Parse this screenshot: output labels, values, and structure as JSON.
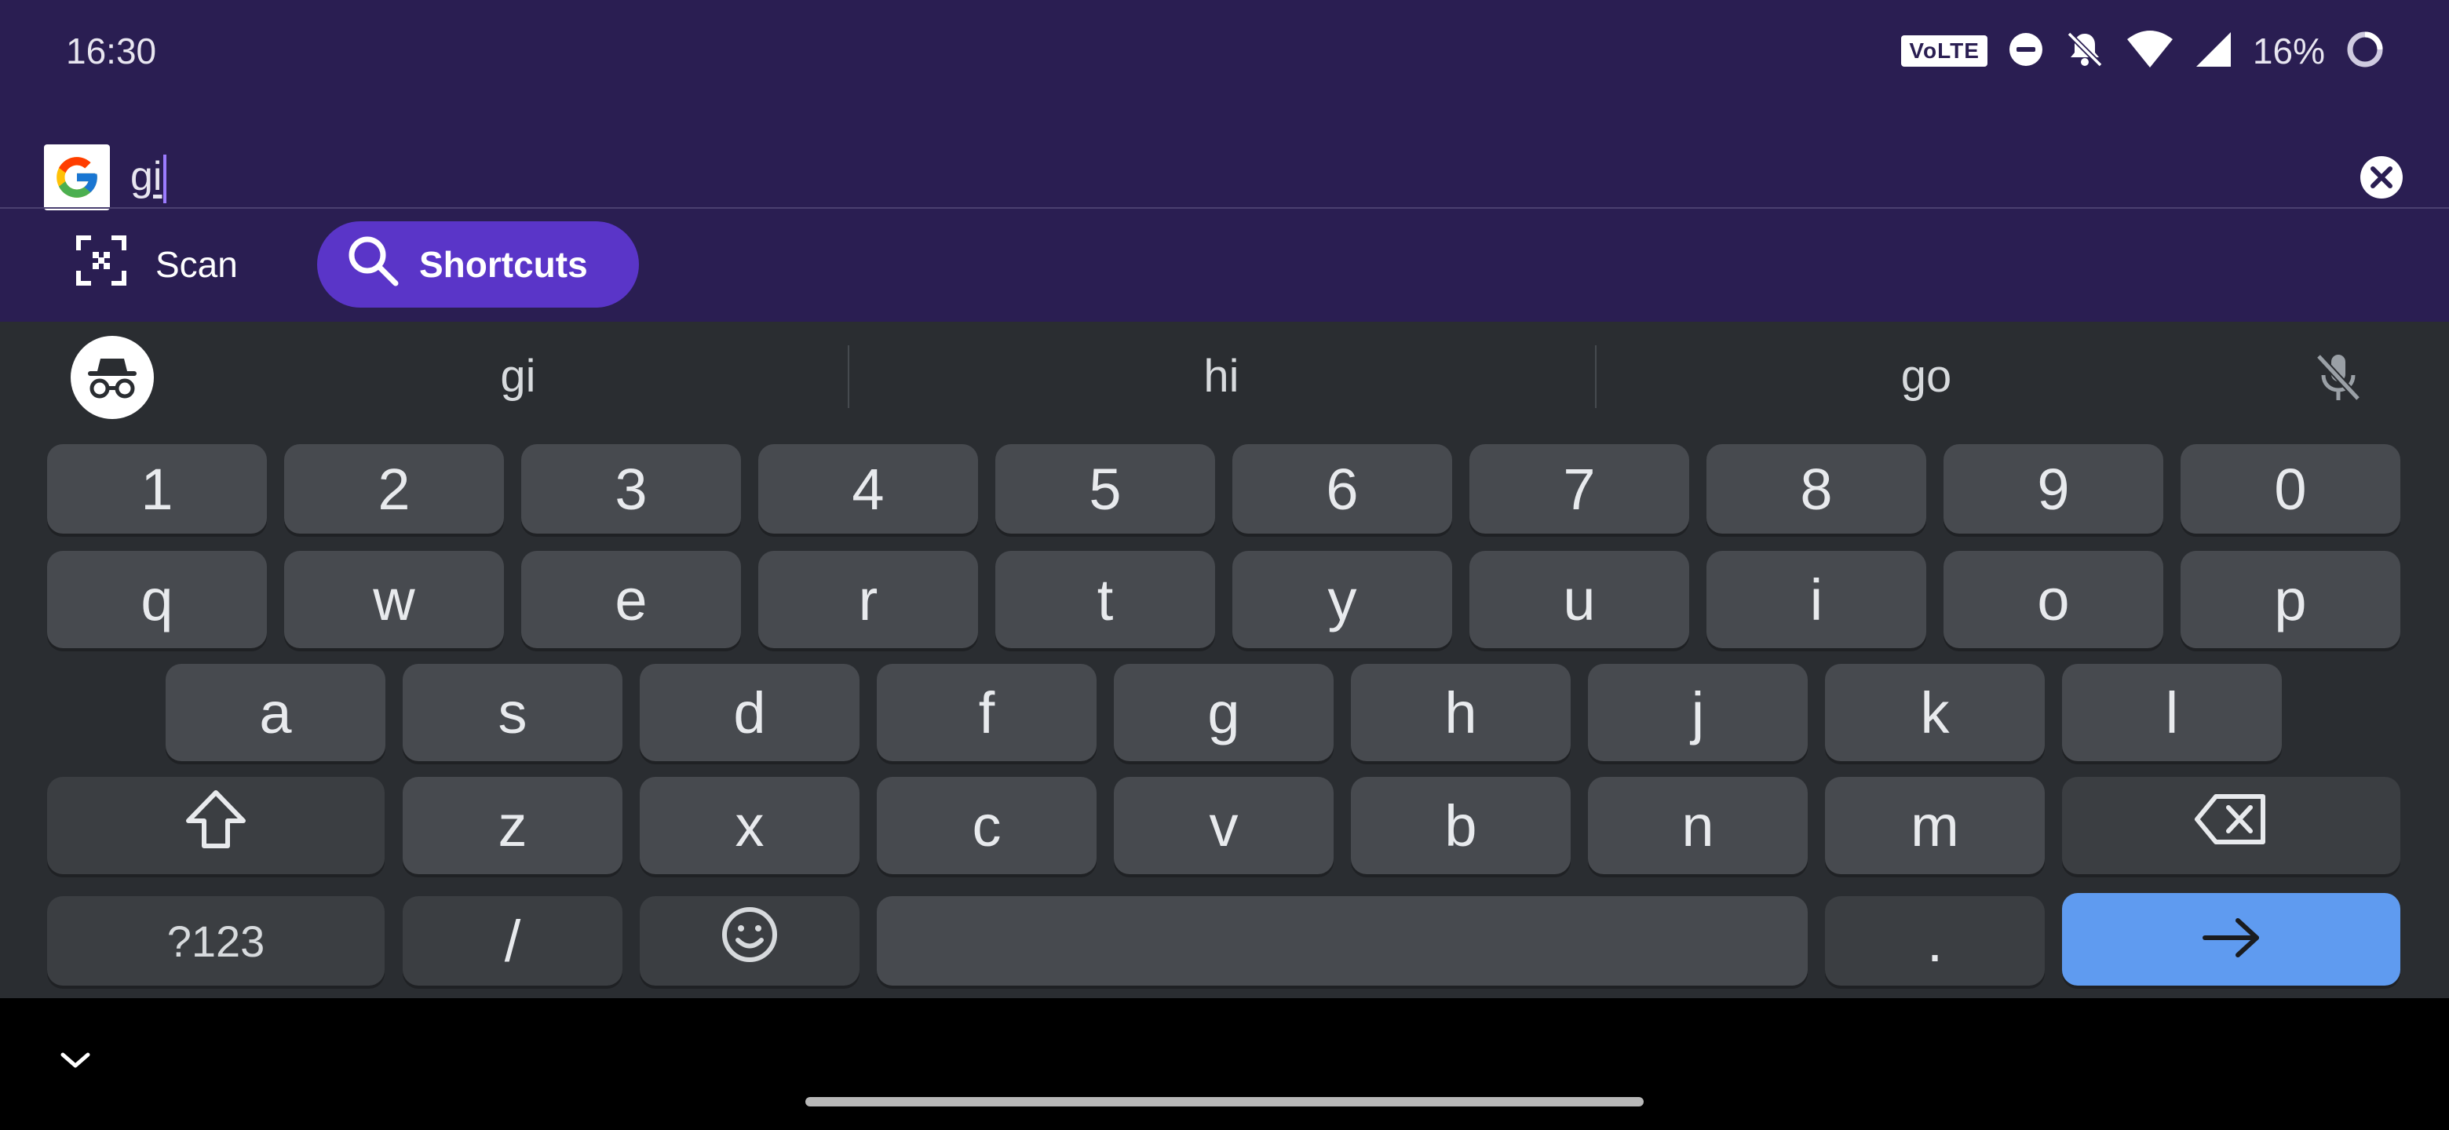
{
  "status_bar": {
    "time": "16:30",
    "volte_label": "VoLTE",
    "battery_text": "16%"
  },
  "search": {
    "query": "gi"
  },
  "chips": {
    "scan_label": "Scan",
    "shortcuts_label": "Shortcuts"
  },
  "suggestions": [
    "gi",
    "hi",
    "go"
  ],
  "keyboard": {
    "number_row": [
      "1",
      "2",
      "3",
      "4",
      "5",
      "6",
      "7",
      "8",
      "9",
      "0"
    ],
    "row1": [
      "q",
      "w",
      "e",
      "r",
      "t",
      "y",
      "u",
      "i",
      "o",
      "p"
    ],
    "row2": [
      "a",
      "s",
      "d",
      "f",
      "g",
      "h",
      "j",
      "k",
      "l"
    ],
    "row3": [
      "z",
      "x",
      "c",
      "v",
      "b",
      "n",
      "m"
    ],
    "symbols_label": "?123",
    "slash_label": "/",
    "period_label": "."
  },
  "colors": {
    "top_bg": "#2a1e52",
    "accent_chip": "#5a35c8",
    "keyboard_bg": "#2a2d31",
    "key_bg": "#474a4f",
    "enter_key": "#5f9bf0"
  },
  "icons": {
    "status": [
      "do-not-disturb-icon",
      "bell-off-icon",
      "wifi-icon",
      "cell-signal-icon",
      "battery-saver-icon"
    ],
    "search_logo": "google-g-logo",
    "clear": "clear-circle-icon",
    "scan": "qr-scan-icon",
    "shortcuts": "search-icon",
    "incognito": "incognito-icon",
    "mic": "mic-off-icon",
    "shift": "shift-arrow-icon",
    "backspace": "backspace-icon",
    "emoji": "emoji-icon",
    "enter": "arrow-right-icon",
    "nav": "chevron-down-icon"
  }
}
